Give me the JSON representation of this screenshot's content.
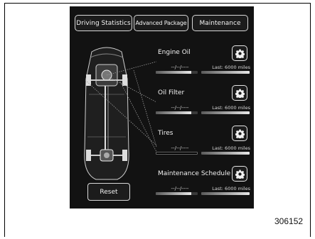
{
  "tabs": {
    "driving_statistics": "Driving Statistics",
    "advanced_package": "Advanced Package",
    "maintenance": "Maintenance"
  },
  "items": {
    "engine_oil": {
      "title": "Engine Oil",
      "date": "--/--/----",
      "last": "Last: 6000 miles",
      "bar1_level": 0.85,
      "bar2_level": 1.0
    },
    "oil_filter": {
      "title": "Oil Filter",
      "date": "--/--/----",
      "last": "Last: 6000 miles",
      "bar1_level": 0.85,
      "bar2_level": 1.0
    },
    "tires": {
      "title": "Tires",
      "date": "--/--/----",
      "last": "Last: 6000 miles",
      "bar1_level": 0.0,
      "bar2_level": 1.0
    },
    "maintenance_schedule": {
      "title": "Maintenance Schedule",
      "date": "--/--/----",
      "last": "Last: 6000 miles",
      "bar1_level": 0.85,
      "bar2_level": 1.0
    }
  },
  "reset_label": "Reset",
  "figure_number": "306152",
  "icons": {
    "settings": "gear-icon",
    "vehicle": "car-chassis-icon"
  },
  "colors": {
    "screen_bg": "#121212",
    "text": "#f2f2f2",
    "border": "#d9d9d9"
  }
}
